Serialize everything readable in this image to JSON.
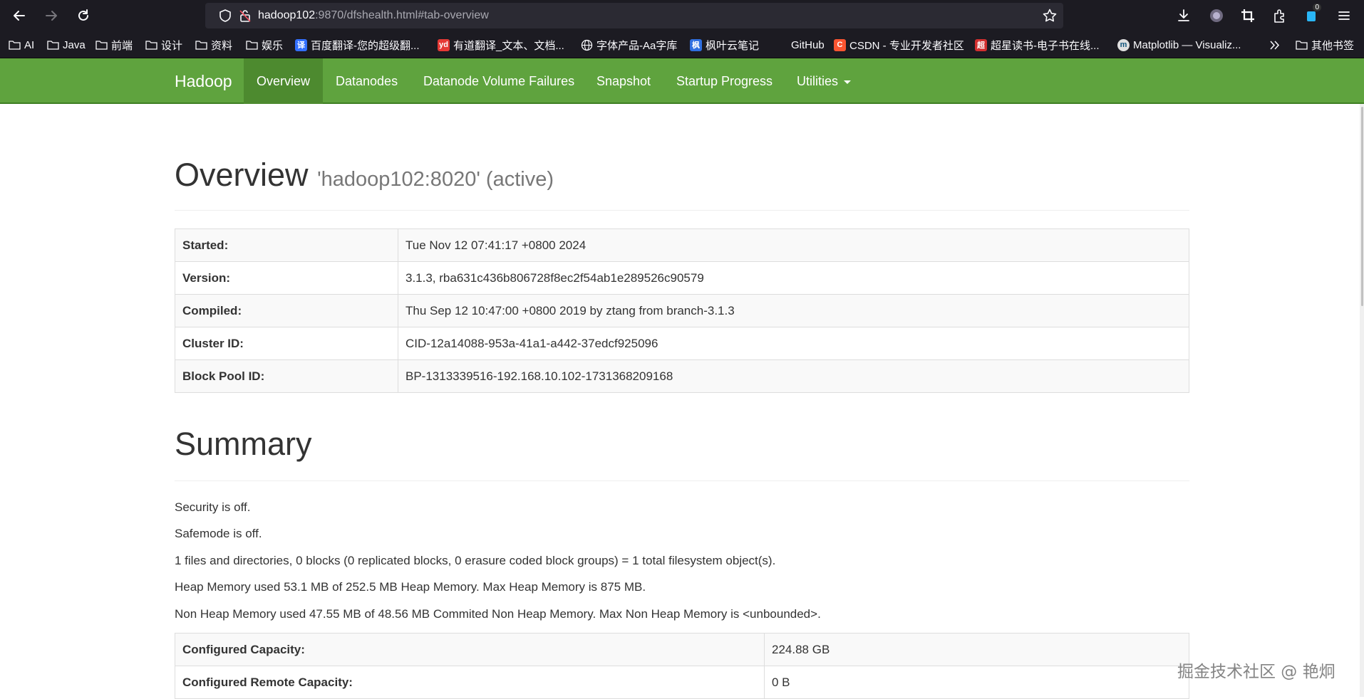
{
  "browser": {
    "url_host": "hadoop102",
    "url_rest": ":9870/dfshealth.html#tab-overview",
    "download_badge": "0",
    "bookmarks": [
      {
        "label": "AI",
        "icon": "folder-icon"
      },
      {
        "label": "Java",
        "icon": "folder-icon"
      },
      {
        "label": "前端",
        "icon": "folder-icon"
      },
      {
        "label": "设计",
        "icon": "folder-icon"
      },
      {
        "label": "资料",
        "icon": "folder-icon"
      },
      {
        "label": "娱乐",
        "icon": "folder-icon"
      },
      {
        "label": "百度翻译-您的超级翻...",
        "icon": "baidu-translate-icon"
      },
      {
        "label": "有道翻译_文本、文档...",
        "icon": "youdao-icon"
      },
      {
        "label": "字体产品-Aa字库",
        "icon": "globe-icon"
      },
      {
        "label": "枫叶云笔记",
        "icon": "fengye-icon"
      },
      {
        "label": "GitHub",
        "icon": "github-icon"
      },
      {
        "label": "CSDN - 专业开发者社区",
        "icon": "csdn-icon"
      },
      {
        "label": "超星读书-电子书在线...",
        "icon": "chaoxing-icon"
      },
      {
        "label": "Matplotlib — Visualiz...",
        "icon": "matplotlib-icon"
      }
    ],
    "other_bookmarks": "其他书签"
  },
  "hadoop_nav": {
    "brand": "Hadoop",
    "items": [
      "Overview",
      "Datanodes",
      "Datanode Volume Failures",
      "Snapshot",
      "Startup Progress",
      "Utilities"
    ]
  },
  "overview": {
    "title": "Overview",
    "subtitle": "'hadoop102:8020' (active)",
    "rows": [
      {
        "key": "Started:",
        "value": "Tue Nov 12 07:41:17 +0800 2024"
      },
      {
        "key": "Version:",
        "value": "3.1.3, rba631c436b806728f8ec2f54ab1e289526c90579"
      },
      {
        "key": "Compiled:",
        "value": "Thu Sep 12 10:47:00 +0800 2019 by ztang from branch-3.1.3"
      },
      {
        "key": "Cluster ID:",
        "value": "CID-12a14088-953a-41a1-a442-37edcf925096"
      },
      {
        "key": "Block Pool ID:",
        "value": "BP-1313339516-192.168.10.102-1731368209168"
      }
    ]
  },
  "summary": {
    "title": "Summary",
    "lines": [
      "Security is off.",
      "Safemode is off.",
      "1 files and directories, 0 blocks (0 replicated blocks, 0 erasure coded block groups) = 1 total filesystem object(s).",
      "Heap Memory used 53.1 MB of 252.5 MB Heap Memory. Max Heap Memory is 875 MB.",
      "Non Heap Memory used 47.55 MB of 48.56 MB Commited Non Heap Memory. Max Non Heap Memory is <unbounded>."
    ],
    "rows": [
      {
        "key": "Configured Capacity:",
        "value": "224.88 GB"
      },
      {
        "key": "Configured Remote Capacity:",
        "value": "0 B"
      }
    ]
  },
  "watermark": "掘金技术社区 @ 艳炯"
}
